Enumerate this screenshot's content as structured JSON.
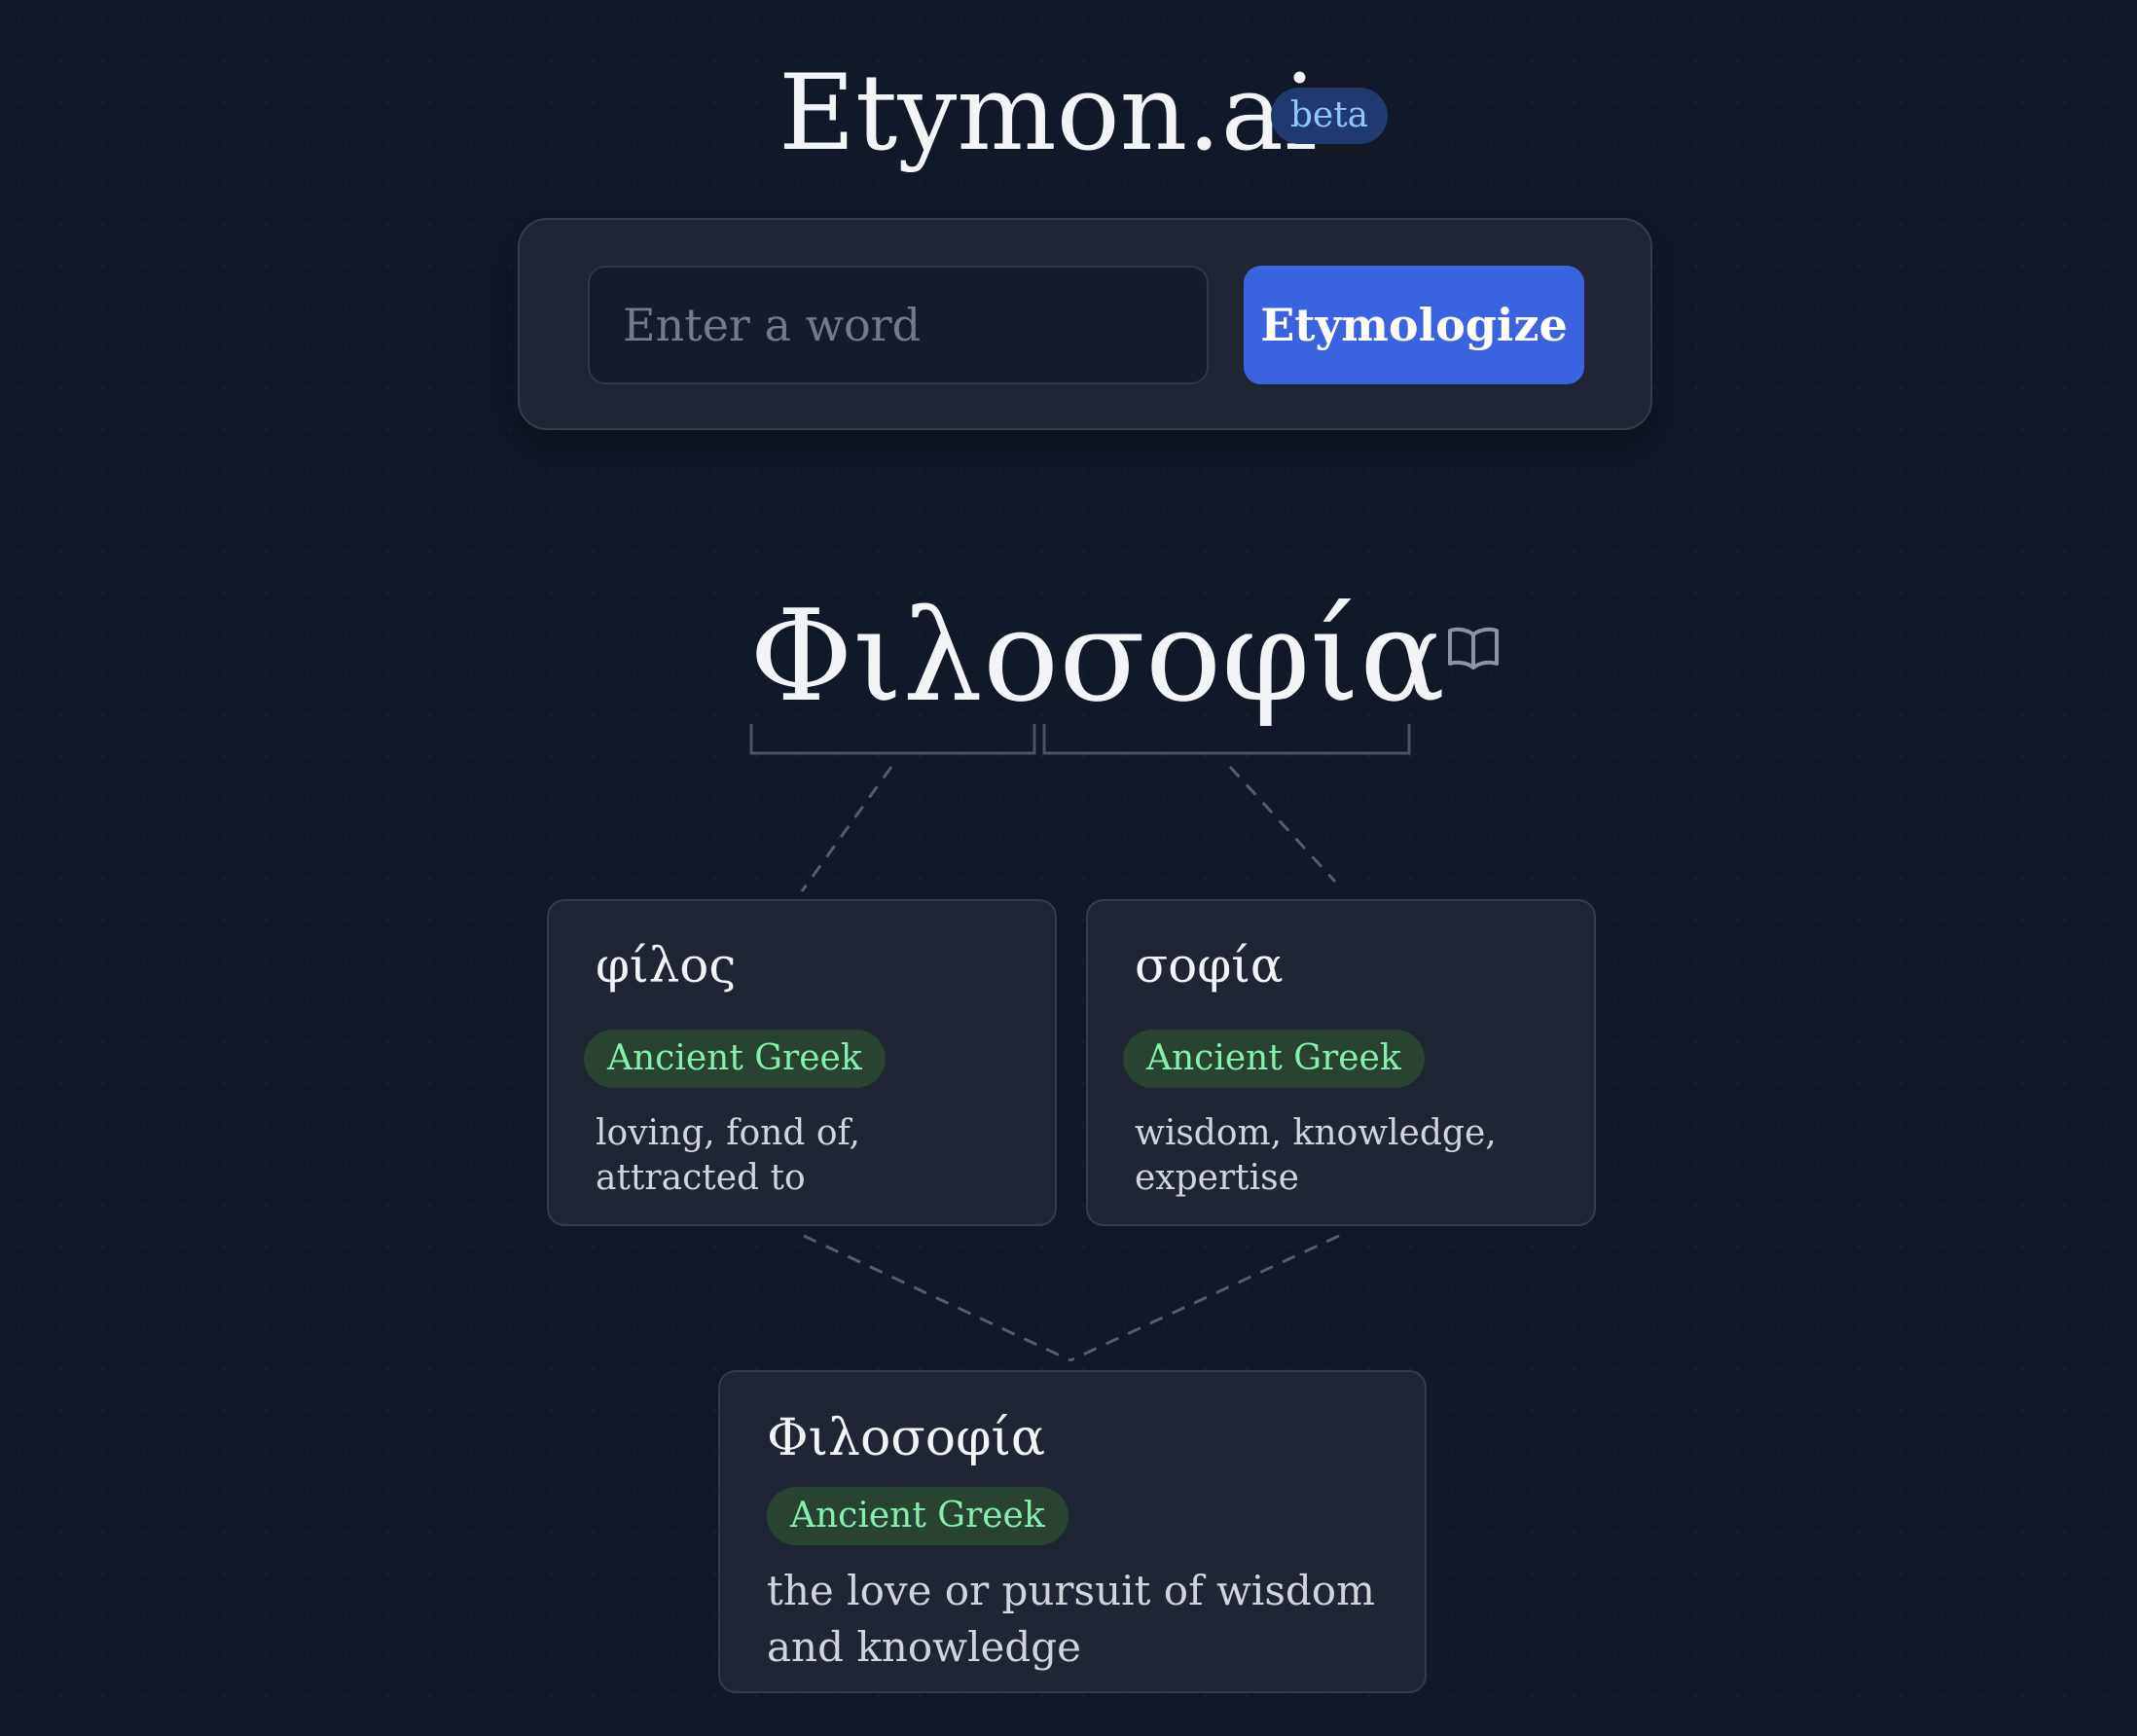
{
  "app": {
    "title": "Etymon.ai",
    "beta_badge": "beta"
  },
  "search": {
    "placeholder": "Enter a word",
    "value": "",
    "button_label": "Etymologize"
  },
  "headword": {
    "text": "Φιλοσοφία",
    "icon": "book-icon"
  },
  "components": [
    {
      "word": "φίλος",
      "language": "Ancient Greek",
      "definition": "loving, fond of, attracted to"
    },
    {
      "word": "σοφία",
      "language": "Ancient Greek",
      "definition": "wisdom, knowledge, expertise"
    }
  ],
  "result": {
    "word": "Φιλοσοφία",
    "language": "Ancient Greek",
    "definition": "the love or pursuit of wisdom and knowledge"
  },
  "colors": {
    "background": "#111827",
    "card": "#1f2533",
    "accent_button": "#3b63e0",
    "language_badge_bg": "#284332",
    "language_badge_text": "#86efac",
    "beta_badge_bg": "#1e3a6e",
    "beta_badge_text": "#93c5fd"
  }
}
